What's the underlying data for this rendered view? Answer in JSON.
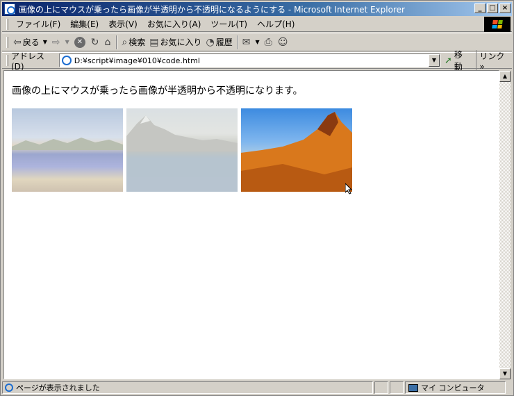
{
  "window": {
    "title": "画像の上にマウスが乗ったら画像が半透明から不透明になるようにする - Microsoft Internet Explorer",
    "minimize": "_",
    "maximize": "□",
    "close": "×"
  },
  "menu": {
    "items": [
      "ファイル(F)",
      "編集(E)",
      "表示(V)",
      "お気に入り(A)",
      "ツール(T)",
      "ヘルプ(H)"
    ]
  },
  "toolbar": {
    "back_label": "戻る",
    "search_label": "検索",
    "favorites_label": "お気に入り",
    "history_label": "履歴"
  },
  "address": {
    "label": "アドレス(D)",
    "value": "D:¥script¥image¥010¥code.html",
    "go_label": "移動",
    "links_label": "リンク"
  },
  "page": {
    "text": "画像の上にマウスが乗ったら画像が半透明から不透明になります。",
    "images": [
      {
        "name": "beach",
        "opacity": 0.55
      },
      {
        "name": "mountain-lake",
        "opacity": 0.5
      },
      {
        "name": "desert-peak",
        "opacity": 1.0
      }
    ]
  },
  "status": {
    "message": "ページが表示されました",
    "zone": "マイ コンピュータ"
  }
}
